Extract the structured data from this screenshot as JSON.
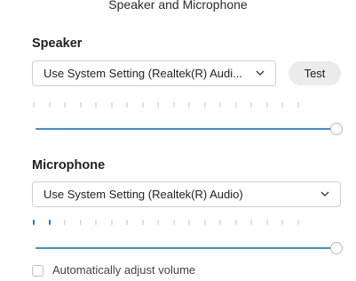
{
  "title": "Speaker and Microphone",
  "speaker": {
    "label": "Speaker",
    "device": "Use System Setting (Realtek(R) Audi...",
    "test_button": "Test",
    "output_level": 0,
    "volume": 1.0
  },
  "microphone": {
    "label": "Microphone",
    "device": "Use System Setting (Realtek(R) Audio)",
    "input_level_segments_active": 2,
    "volume": 1.0
  },
  "auto_adjust": {
    "label": "Automatically adjust volume",
    "checked": false
  },
  "colors": {
    "accent": "#3b8edd",
    "meter_active": "#2b78d0",
    "meter_inactive": "#dedede"
  },
  "icons": {
    "dropdown": "chevron-down-icon"
  }
}
